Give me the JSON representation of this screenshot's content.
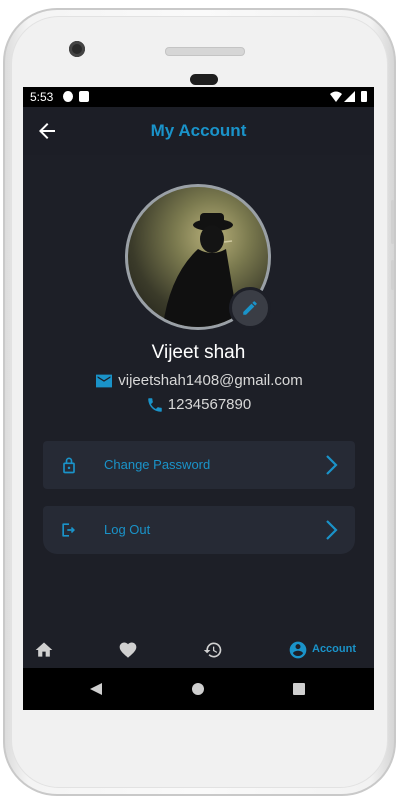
{
  "status": {
    "time": "5:53"
  },
  "appbar": {
    "title": "My Account"
  },
  "profile": {
    "name": "Vijeet shah",
    "email": "vijeetshah1408@gmail.com",
    "phone": "1234567890"
  },
  "menu": [
    {
      "label": "Change Password",
      "icon": "lock-icon"
    },
    {
      "label": "Log Out",
      "icon": "logout-icon"
    }
  ],
  "bottom_nav": {
    "items": [
      "home-icon",
      "heart-icon",
      "history-icon",
      "account-icon"
    ],
    "active_label": "Account"
  },
  "colors": {
    "accent": "#1a93c9",
    "background": "#1d1f27",
    "card": "#262a35"
  }
}
